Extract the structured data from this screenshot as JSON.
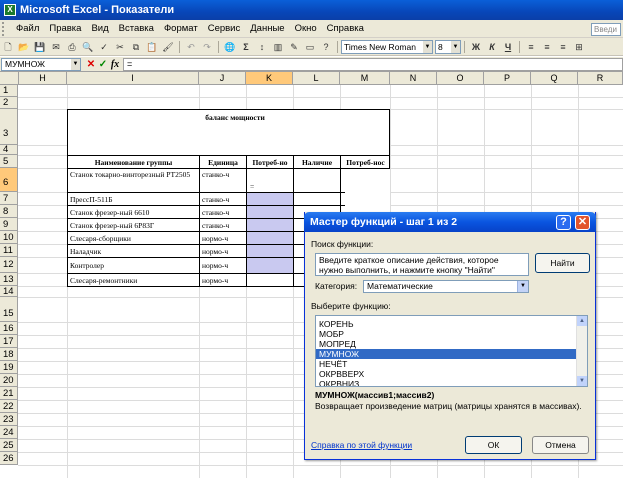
{
  "title": "Microsoft Excel - Показатели",
  "menu": [
    "Файл",
    "Правка",
    "Вид",
    "Вставка",
    "Формат",
    "Сервис",
    "Данные",
    "Окно",
    "Справка"
  ],
  "help_search": "Введи",
  "toolbar": {
    "font": "Times New Roman",
    "size": "8"
  },
  "namebox": "МУМНОЖ",
  "formula": "=",
  "columns": [
    "H",
    "I",
    "J",
    "K",
    "L",
    "M",
    "N",
    "O",
    "P",
    "Q",
    "R"
  ],
  "rows": [
    "1",
    "2",
    "3",
    "4",
    "5",
    "6",
    "7",
    "8",
    "9",
    "10",
    "11",
    "12",
    "13",
    "14",
    "15",
    "16",
    "17",
    "18",
    "19",
    "20",
    "21",
    "22",
    "23",
    "24",
    "25",
    "26"
  ],
  "sheet": {
    "table_title": "баланс мощности",
    "headers": [
      "Наименование группы",
      "Единица",
      "Потреб-но",
      "Наличие",
      "Потреб-нос"
    ],
    "rows": [
      {
        "name": "Станок токарно-винторезный РТ2505",
        "unit": "станко-ч"
      },
      {
        "name": "ПрессП-511Б",
        "unit": "станко-ч"
      },
      {
        "name": "Станок фрезер-ный 6610",
        "unit": "станко-ч"
      },
      {
        "name": "Станок фрезер-ный 6Р83Г",
        "unit": "станко-ч"
      },
      {
        "name": "Слесаря-сборщики",
        "unit": "нормо-ч"
      },
      {
        "name": "Наладчик",
        "unit": "нормо-ч"
      },
      {
        "name": "Контролер",
        "unit": "нормо-ч"
      },
      {
        "name": "Слесаря-ремонтники",
        "unit": "нормо-ч"
      }
    ],
    "active_cell_text": "="
  },
  "dialog": {
    "title": "Мастер функций - шаг 1 из 2",
    "search_label": "Поиск функции:",
    "search_text": "Введите краткое описание действия, которое нужно выполнить, и нажмите кнопку \"Найти\"",
    "find_button": "Найти",
    "category_label": "Категория:",
    "category_value": "Математические",
    "select_label": "Выберите функцию:",
    "functions": [
      "КОРЕНЬ",
      "МОБР",
      "МОПРЕД",
      "МУМНОЖ",
      "НЕЧЁТ",
      "ОКРВВЕРХ",
      "ОКРВНИЗ"
    ],
    "selected_index": 3,
    "signature": "МУМНОЖ(массив1;массив2)",
    "description": "Возвращает произведение матриц (матрицы хранятся в массивах).",
    "help_link": "Справка по этой функции",
    "ok": "ОК",
    "cancel": "Отмена"
  }
}
